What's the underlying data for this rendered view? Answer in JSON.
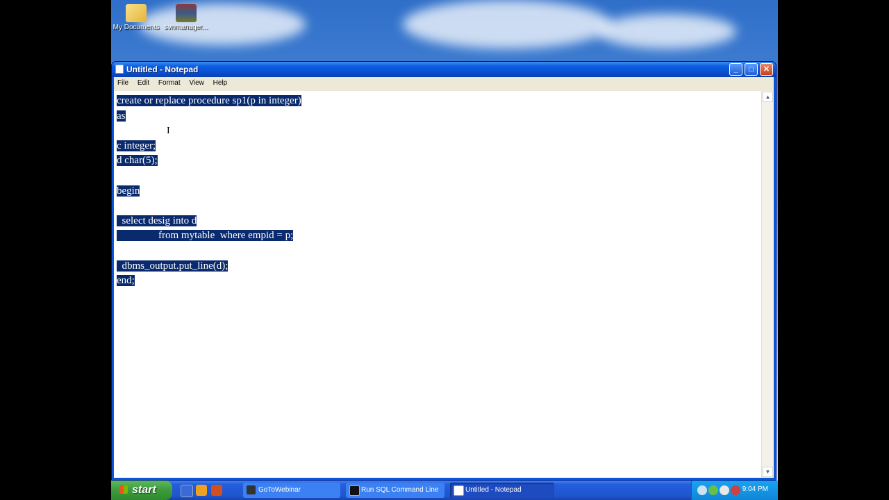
{
  "desktop": {
    "icons": [
      {
        "label": "My Documents",
        "icon": "folder-icon"
      },
      {
        "label": "svnmanager...",
        "icon": "archive-icon"
      }
    ]
  },
  "window": {
    "title": "Untitled - Notepad",
    "buttons": {
      "minimize": "_",
      "maximize": "□",
      "close": "✕"
    },
    "menu": [
      "File",
      "Edit",
      "Format",
      "View",
      "Help"
    ]
  },
  "editor": {
    "selected": true,
    "lines": [
      "create or replace procedure sp1(p in integer)",
      "as",
      "",
      "c integer;",
      "d char(5);",
      "",
      "begin",
      "",
      "  select desig into d",
      "                from mytable  where empid = p;",
      "",
      "  dbms_output.put_line(d);",
      "end;"
    ]
  },
  "taskbar": {
    "start_label": "start",
    "tasks": [
      {
        "label": "GoToWebinar",
        "icon": "gotowebinar-icon"
      },
      {
        "label": "Run SQL Command Line",
        "icon": "terminal-icon"
      },
      {
        "label": "Untitled - Notepad",
        "icon": "notepad-icon",
        "active": true
      }
    ],
    "clock": "9:04 PM"
  }
}
